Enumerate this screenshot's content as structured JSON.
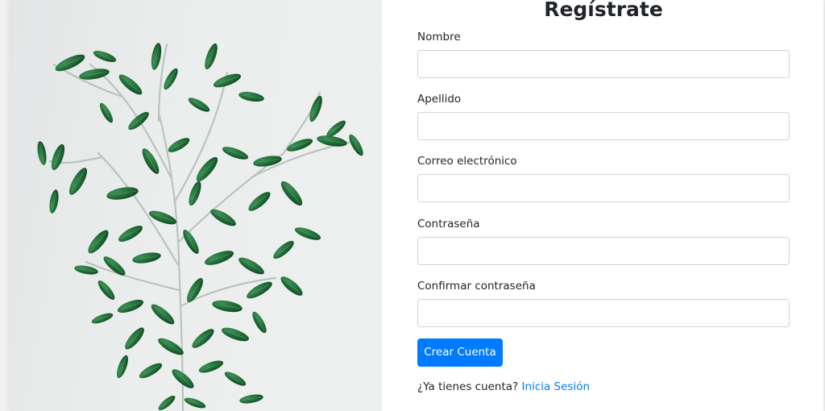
{
  "colors": {
    "accent": "#007bff",
    "text": "#212529",
    "input_border": "#ced4da"
  },
  "image": {
    "subject": "plant-branch"
  },
  "form": {
    "title": "Regístrate",
    "fields": [
      {
        "label": "Nombre",
        "value": ""
      },
      {
        "label": "Apellido",
        "value": ""
      },
      {
        "label": "Correo electrónico",
        "value": ""
      },
      {
        "label": "Contraseña",
        "value": ""
      },
      {
        "label": "Confirmar contraseña",
        "value": ""
      }
    ],
    "submit_label": "Crear Cuenta",
    "login_prompt": "¿Ya tienes cuenta?",
    "login_link": "Inicia Sesión"
  }
}
